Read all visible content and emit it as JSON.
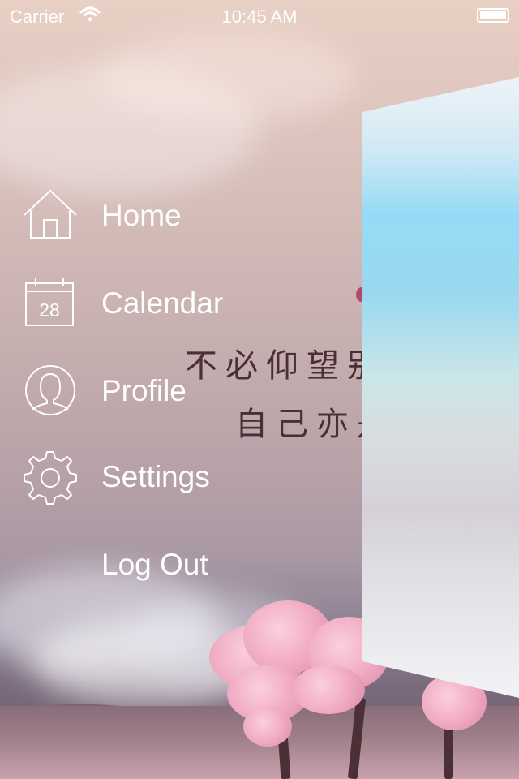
{
  "status_bar": {
    "carrier": "Carrier",
    "time": "10:45 AM",
    "battery_level": 1.0
  },
  "background": {
    "text_line_1": "不必仰望别",
    "text_line_2": "自己亦是"
  },
  "menu": {
    "items": [
      {
        "label": "Home",
        "icon": "house-icon"
      },
      {
        "label": "Calendar",
        "icon": "calendar-icon",
        "icon_text": "28"
      },
      {
        "label": "Profile",
        "icon": "user-icon"
      },
      {
        "label": "Settings",
        "icon": "gear-icon"
      },
      {
        "label": "Log Out",
        "icon": ""
      }
    ]
  },
  "colors": {
    "menu_text": "#ffffff",
    "panel_sky": "#8ed7f3",
    "background_pink": "#dcc3bd"
  }
}
